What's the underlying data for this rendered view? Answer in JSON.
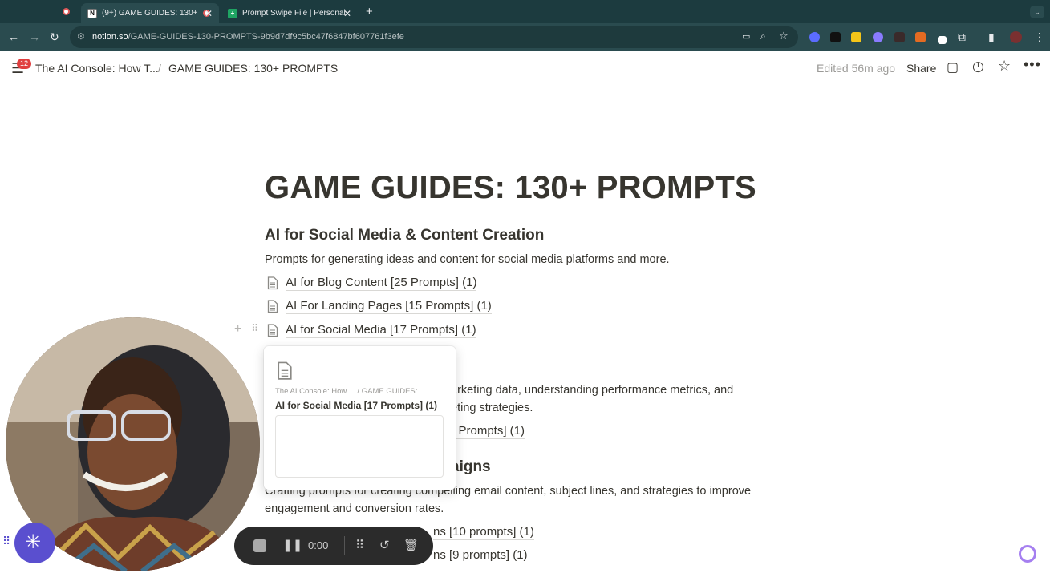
{
  "browser": {
    "tabs": [
      {
        "title": "(9+) GAME GUIDES: 130+",
        "active": true
      },
      {
        "title": "Prompt Swipe File | Personal",
        "active": false
      }
    ],
    "url_host": "notion.so",
    "url_path": "/GAME-GUIDES-130-PROMPTS-9b9d7df9c5bc47f6847bf607761f3efe"
  },
  "notion_topbar": {
    "notification_count": "12",
    "breadcrumb_parent": "The AI Console: How T...",
    "breadcrumb_separator": "/",
    "breadcrumb_current": "GAME GUIDES: 130+ PROMPTS",
    "edited": "Edited 56m ago",
    "share_label": "Share"
  },
  "page": {
    "title": "GAME GUIDES: 130+ PROMPTS",
    "section1": {
      "heading": "AI for Social Media & Content Creation",
      "description": "Prompts for generating ideas and content for social media platforms and more.",
      "links": [
        "AI for Blog Content [25 Prompts] (1)",
        "AI For Landing Pages [15 Prompts] (1)",
        "AI for Social Media [17 Prompts] (1)"
      ]
    },
    "section2": {
      "description_line1": "arketing data, understanding performance metrics, and",
      "description_line2": "eting strategies.",
      "link_tail": "l Prompts] (1)"
    },
    "section3": {
      "heading_tail": "aigns",
      "description_line1": "Crafting prompts for creating compelling email content, subject lines, and strategies to improve",
      "description_line2": "engagement and conversion rates.",
      "link1_tail": "ns [10 prompts] (1)",
      "link2_tail": "ns [9 prompts] (1)"
    }
  },
  "preview_card": {
    "path": "The AI Console: How ...  /  GAME GUIDES: ...",
    "title": "AI for Social Media [17 Prompts] (1)"
  },
  "recorder": {
    "time": "0:00"
  },
  "colors": {
    "tab_strip": "#1c3b3f",
    "toolbar": "#2a4b4f",
    "text": "#37352f",
    "muted": "#9b9a97",
    "badge": "#e03e3e"
  }
}
